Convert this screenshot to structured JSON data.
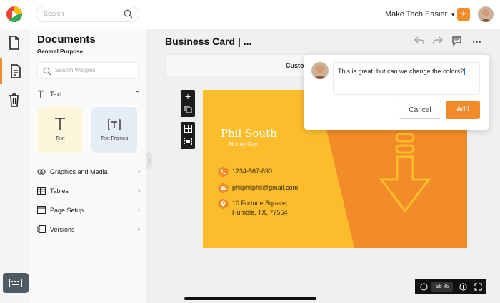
{
  "search": {
    "placeholder": "Search"
  },
  "workspace": {
    "name": "Make Tech Easier"
  },
  "panel": {
    "title": "Documents",
    "subtitle": "General Purpose",
    "widget_search_placeholder": "Search Widgets",
    "text_section": "Text",
    "cards": [
      {
        "label": "Text",
        "icon": "text-icon"
      },
      {
        "label": "Text Frames",
        "icon": "text-frame-icon"
      }
    ],
    "sections": [
      {
        "label": "Graphics and Media",
        "icon": "graphics-icon"
      },
      {
        "label": "Tables",
        "icon": "table-icon"
      },
      {
        "label": "Page Setup",
        "icon": "page-setup-icon"
      },
      {
        "label": "Versions",
        "icon": "versions-icon"
      }
    ]
  },
  "document": {
    "title": "Business Card | ...",
    "toolbar_label": "Custo"
  },
  "business_card": {
    "name": "Phil South",
    "role": "Money Guy",
    "phone": "1234-567-890",
    "email": "philphilphil@gmail.com",
    "address_line1": "10 Fortune Square,",
    "address_line2": "Humble, TX, 77564",
    "colors": {
      "yellow": "#fbbd2c",
      "orange": "#f28c28"
    }
  },
  "comment": {
    "text": "This is great, but can we change the colors?",
    "cancel_label": "Cancel",
    "add_label": "Add"
  },
  "zoom": {
    "value": "56",
    "unit": "%"
  },
  "colors": {
    "accent": "#f28c28",
    "dark": "#1c1c1c"
  }
}
